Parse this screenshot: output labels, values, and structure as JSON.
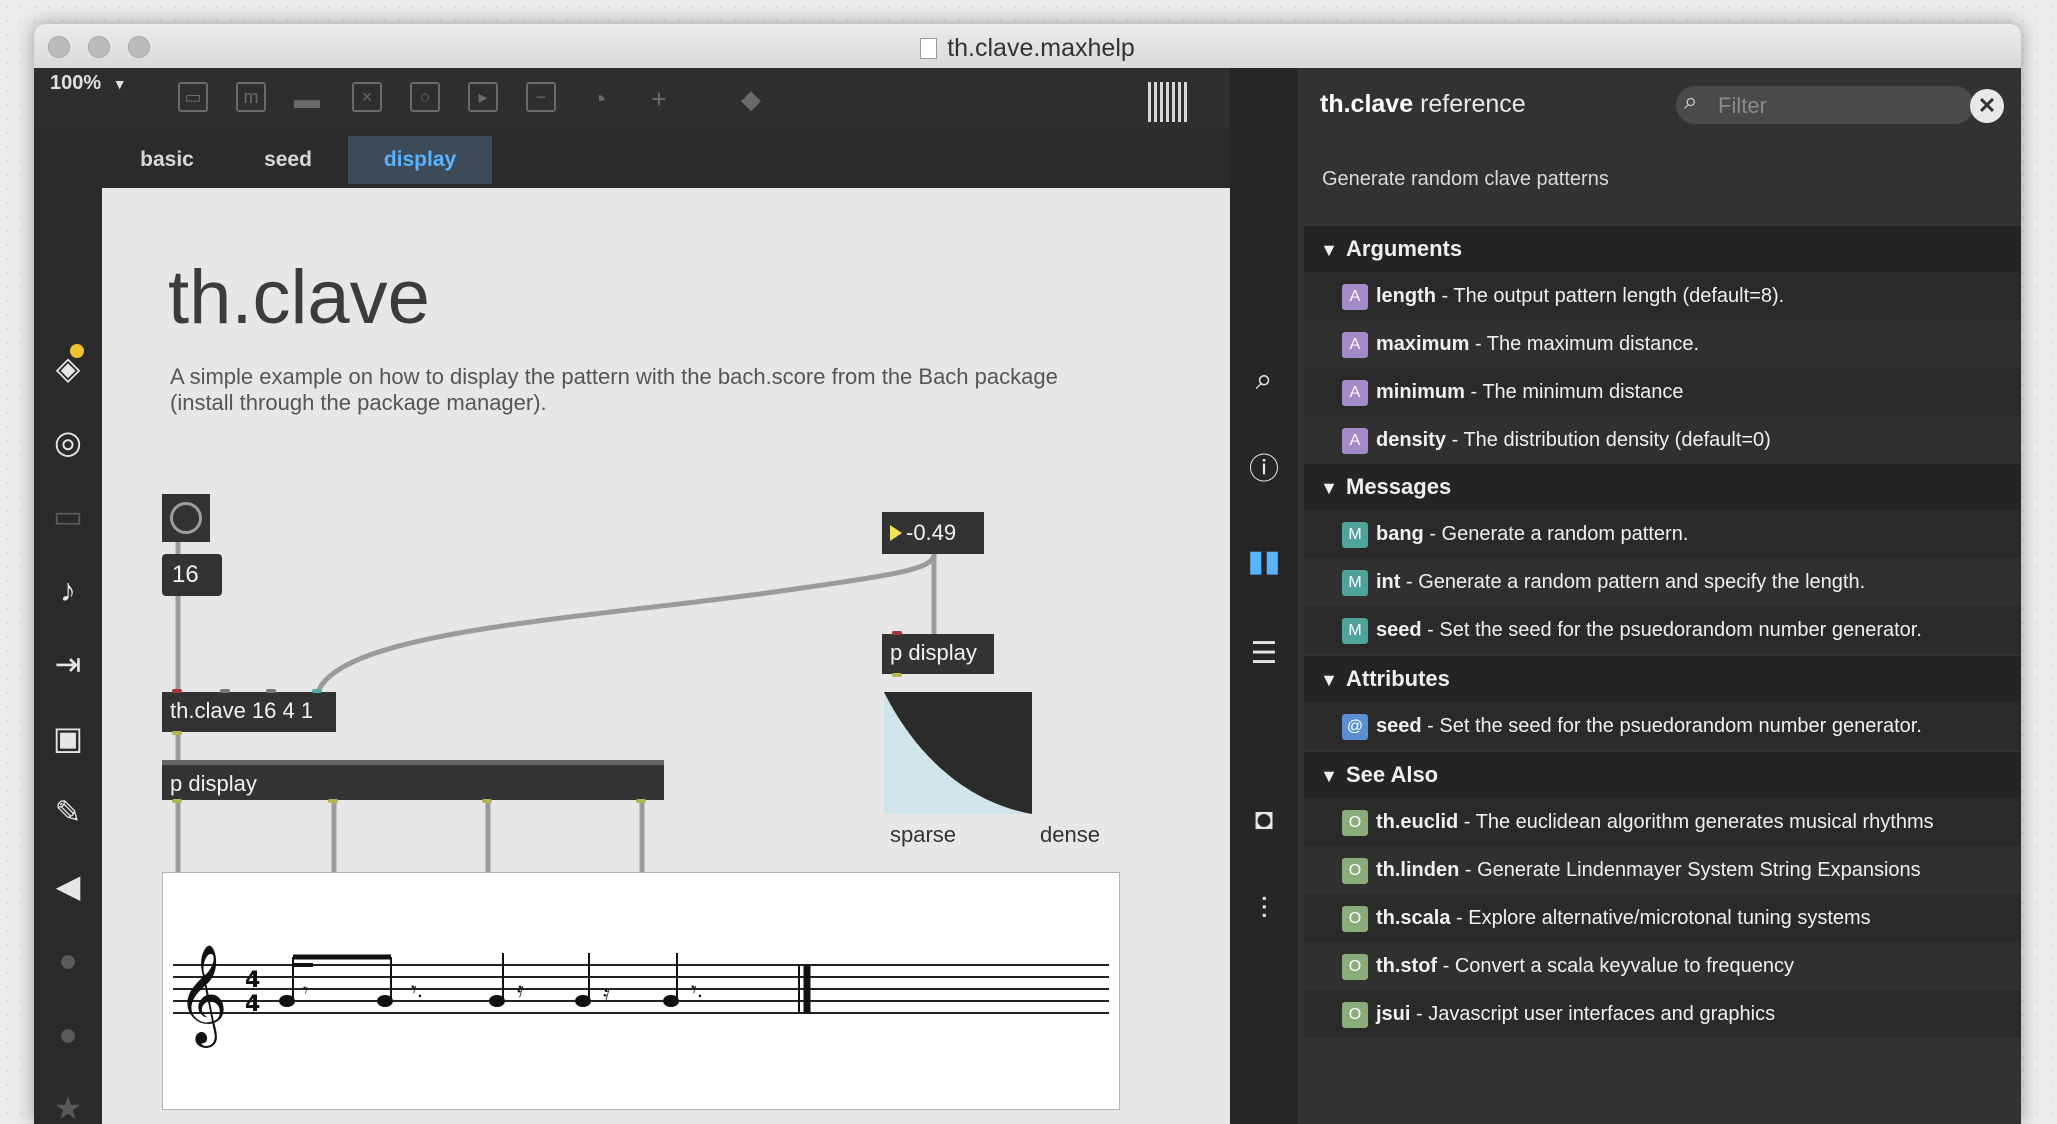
{
  "window": {
    "title": "th.clave.maxhelp"
  },
  "toolbar": {
    "zoom": "100%",
    "zoom_caret": "▼"
  },
  "tabs": [
    {
      "label": "basic"
    },
    {
      "label": "seed"
    },
    {
      "label": "display"
    }
  ],
  "patch": {
    "title": "th.clave",
    "description": "A simple example on how to display the pattern with the bach.score from the Bach package (install through the package manager).",
    "number_value": "16",
    "float_value": "-0.49",
    "clave_object": "th.clave 16 4 1",
    "display_object_small": "p display",
    "display_object_wide": "p display",
    "curve_label_left": "sparse",
    "curve_label_right": "dense"
  },
  "reference": {
    "title_name": "th.clave",
    "title_suffix": "reference",
    "filter_placeholder": "Filter",
    "description": "Generate random clave patterns",
    "sections": {
      "arguments": {
        "label": "Arguments",
        "items": [
          {
            "badge": "A",
            "name": "length",
            "text": " - The output pattern length (default=8)."
          },
          {
            "badge": "A",
            "name": "maximum",
            "text": " - The maximum distance."
          },
          {
            "badge": "A",
            "name": "minimum",
            "text": " - The minimum distance"
          },
          {
            "badge": "A",
            "name": "density",
            "text": " - The distribution density (default=0)"
          }
        ]
      },
      "messages": {
        "label": "Messages",
        "items": [
          {
            "badge": "M",
            "name": "bang",
            "text": " - Generate a random pattern."
          },
          {
            "badge": "M",
            "name": "int",
            "text": " - Generate a random pattern and specify the length."
          },
          {
            "badge": "M",
            "name": "seed",
            "text": " - Set the seed for the psuedorandom number generator."
          }
        ]
      },
      "attributes": {
        "label": "Attributes",
        "items": [
          {
            "badge": "@",
            "name": "seed",
            "text": " - Set the seed for the psuedorandom number generator."
          }
        ]
      },
      "see_also": {
        "label": "See Also",
        "items": [
          {
            "badge": "O",
            "name": "th.euclid",
            "text": " - The euclidean algorithm generates musical rhythms"
          },
          {
            "badge": "O",
            "name": "th.linden",
            "text": " - Generate Lindenmayer System String Expansions"
          },
          {
            "badge": "O",
            "name": "th.scala",
            "text": " - Explore alternative/microtonal tuning systems"
          },
          {
            "badge": "O",
            "name": "th.stof",
            "text": " - Convert a scala keyvalue to frequency"
          },
          {
            "badge": "O",
            "name": "jsui",
            "text": " - Javascript user interfaces and graphics"
          }
        ]
      }
    }
  },
  "colors": {
    "accent": "#58b4ff",
    "tab_active_bg": "#3d4b59",
    "badge_A": "#a48ac9",
    "badge_M": "#4fa39b",
    "badge_at": "#5b8fd3",
    "badge_O": "#8aab7a"
  },
  "icons": {
    "left_sidebar": [
      "package-icon",
      "target-icon",
      "keyboard-icon",
      "music-note-icon",
      "step-sequencer-icon",
      "image-icon",
      "paperclip-icon",
      "plugin-icon",
      "vimeo-icon",
      "beatport-icon",
      "star-icon"
    ],
    "center_sidebar": [
      "search-icon",
      "info-icon",
      "reference-book-icon",
      "list-icon",
      "snapshot-icon",
      "mixer-icon"
    ]
  }
}
